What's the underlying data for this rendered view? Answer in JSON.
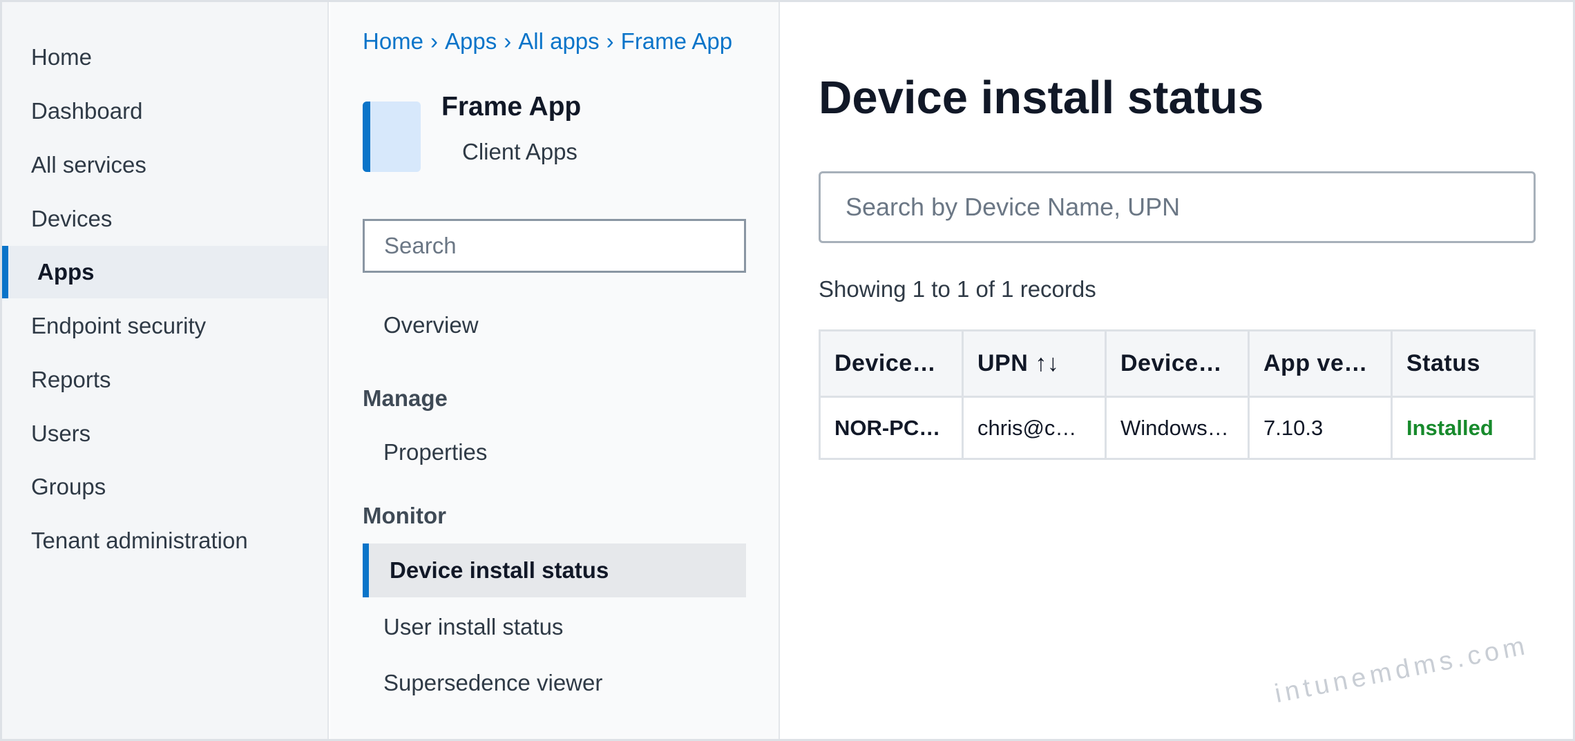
{
  "nav": {
    "items": [
      {
        "label": "Home",
        "active": false
      },
      {
        "label": "Dashboard",
        "active": false
      },
      {
        "label": "All services",
        "active": false
      },
      {
        "label": "Devices",
        "active": false
      },
      {
        "label": "Apps",
        "active": true
      },
      {
        "label": "Endpoint security",
        "active": false
      },
      {
        "label": "Reports",
        "active": false
      },
      {
        "label": "Users",
        "active": false
      },
      {
        "label": "Groups",
        "active": false
      },
      {
        "label": "Tenant administration",
        "active": false
      }
    ]
  },
  "breadcrumb": {
    "items": [
      "Home",
      "Apps",
      "All apps",
      "Frame App"
    ],
    "separator": "›"
  },
  "app": {
    "title": "Frame App",
    "subtitle": "Client Apps"
  },
  "blade": {
    "search_placeholder": "Search",
    "overview_label": "Overview",
    "manage_heading": "Manage",
    "properties_label": "Properties",
    "monitor_heading": "Monitor",
    "monitor_items": [
      "Device install status",
      "User install status",
      "Supersedence viewer"
    ]
  },
  "main": {
    "title": "Device install status",
    "search_placeholder": "Search by Device Name, UPN",
    "records_text": "Showing 1 to 1 of 1 records",
    "columns": [
      "Device…",
      "UPN ↑↓",
      "Device…",
      "App ve…",
      "Status"
    ],
    "rows": [
      [
        "NOR-PC…",
        "chris@c…",
        "Windows…",
        "7.10.3",
        "Installed"
      ]
    ]
  },
  "colors": {
    "accent": "#0a74c9",
    "status_installed": "#178a2c"
  },
  "watermark": "intunemdms.com"
}
